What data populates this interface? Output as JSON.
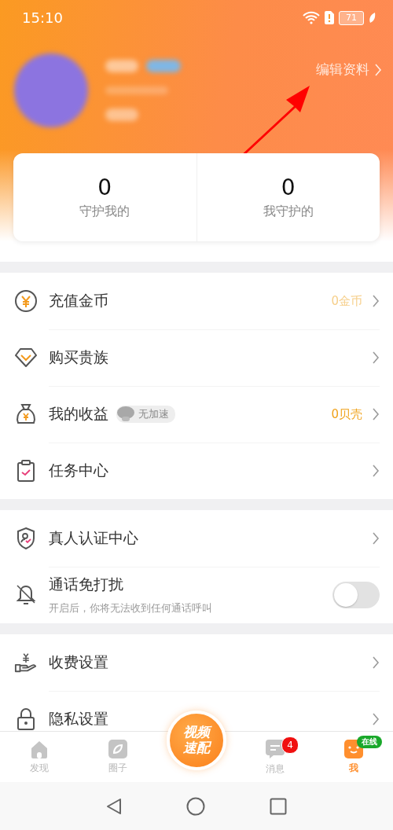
{
  "status_bar": {
    "time": "15:10",
    "battery": "71"
  },
  "profile": {
    "edit_link": "编辑资料"
  },
  "stats": [
    {
      "value": "0",
      "label": "守护我的"
    },
    {
      "value": "0",
      "label": "我守护的"
    }
  ],
  "sections": [
    {
      "items": [
        {
          "kind": "link",
          "label": "充值金币",
          "value": "0金币",
          "dimmed": true
        },
        {
          "kind": "link",
          "label": "购买贵族"
        },
        {
          "kind": "link",
          "label": "我的收益",
          "badge": "无加速",
          "value": "0贝壳",
          "dimmed": false
        },
        {
          "kind": "link",
          "label": "任务中心"
        }
      ]
    },
    {
      "items": [
        {
          "kind": "link",
          "label": "真人认证中心"
        },
        {
          "kind": "toggle",
          "label": "通话免打扰",
          "subtitle": "开启后，你将无法收到任何通话呼叫",
          "on": false
        }
      ]
    },
    {
      "items": [
        {
          "kind": "link",
          "label": "收费设置"
        },
        {
          "kind": "link",
          "label": "隐私设置"
        }
      ]
    }
  ],
  "tabs": [
    {
      "kind": "tab",
      "label": "发现",
      "selected": false
    },
    {
      "kind": "tab",
      "label": "圈子",
      "selected": false
    },
    {
      "kind": "center",
      "label": "视频速配"
    },
    {
      "kind": "tab",
      "label": "消息",
      "selected": false,
      "badge": "4"
    },
    {
      "kind": "tab",
      "label": "我",
      "selected": true,
      "tag": "在线"
    }
  ]
}
